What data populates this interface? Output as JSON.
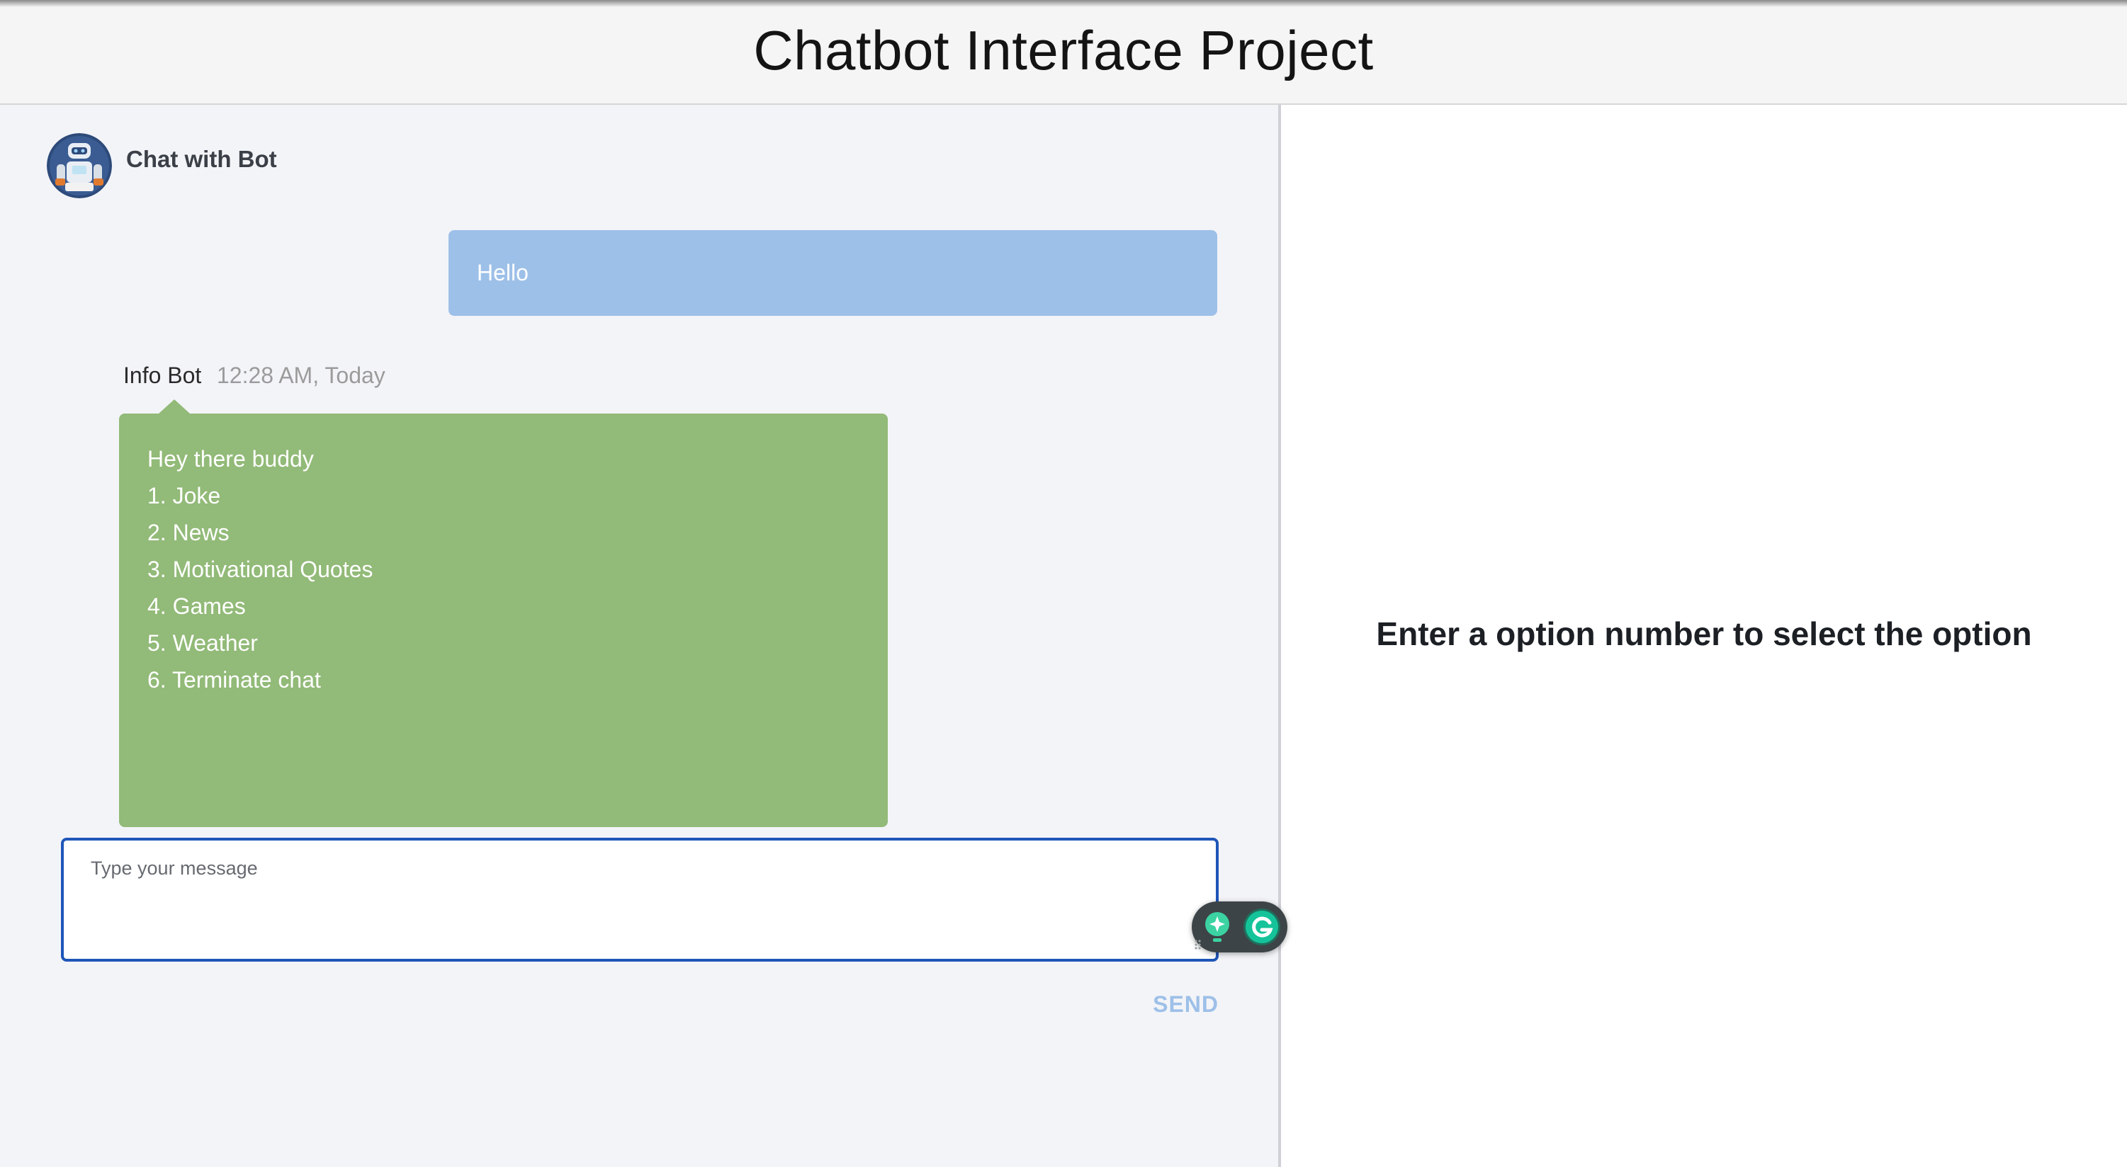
{
  "header": {
    "title": "Chatbot Interface Project"
  },
  "chat": {
    "title": "Chat with Bot",
    "avatar_icon": "robot-avatar-icon",
    "messages": [
      {
        "role": "user",
        "text": "Hello"
      },
      {
        "role": "bot",
        "sender": "Info Bot",
        "timestamp": "12:28 AM, Today",
        "lines": [
          "Hey there buddy",
          "1. Joke",
          "2. News",
          "3. Motivational Quotes",
          "4. Games",
          "5. Weather",
          "6. Terminate chat"
        ]
      }
    ],
    "input": {
      "placeholder": "Type your message",
      "value": ""
    },
    "send_label": "SEND"
  },
  "info_panel": {
    "message": "Enter a option number to select the option"
  },
  "colors": {
    "user_bubble": "#9dc0e8",
    "bot_bubble": "#92ba78",
    "input_border": "#1f56b8",
    "send_text": "#9dc0e8"
  },
  "extension": {
    "icons": [
      "grammarly-assist-icon",
      "grammarly-g-icon"
    ]
  }
}
